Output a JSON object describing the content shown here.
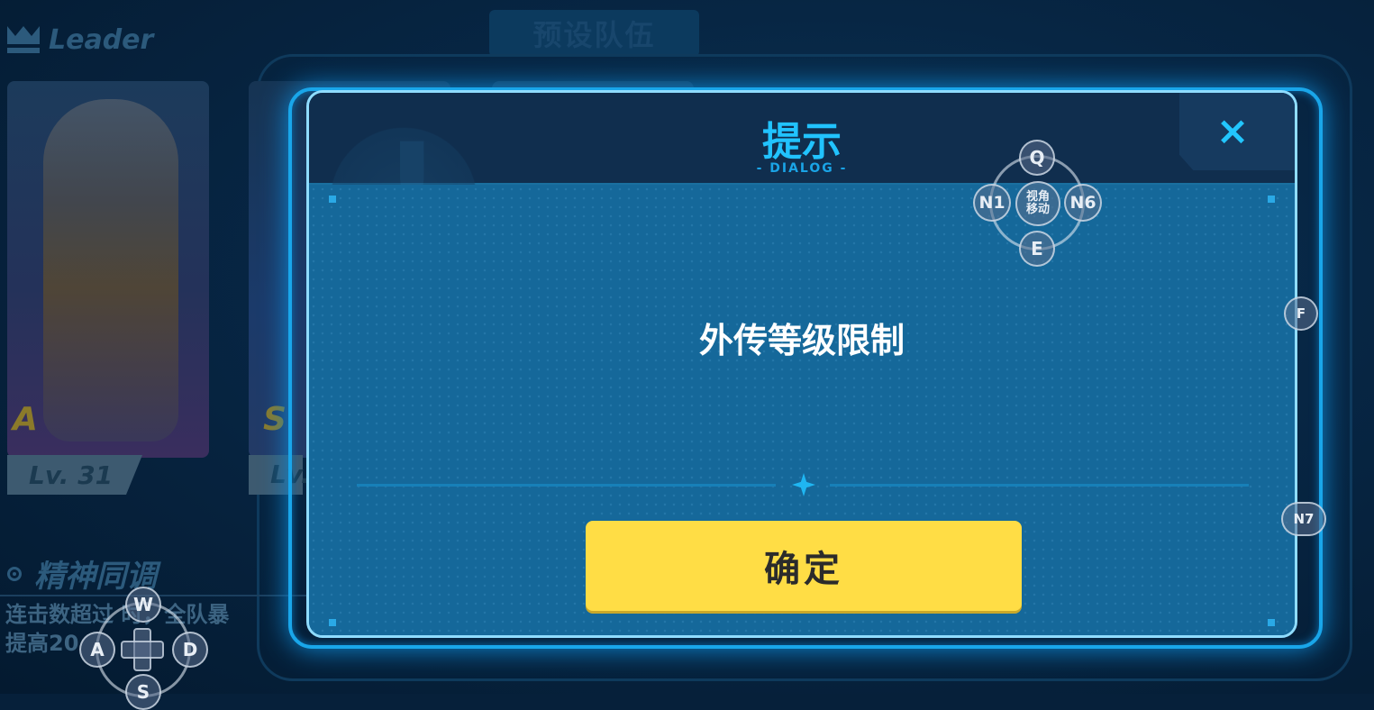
{
  "background": {
    "leader_label": "Leader",
    "preset_team_label": "预设队伍",
    "leader_card": {
      "rank": "A",
      "level": "Lv. 31"
    },
    "second_card": {
      "rank": "S",
      "level": "Lv."
    },
    "skill_title": "精神同调",
    "skill_desc_line1": "连击数超过 时，全队暴",
    "skill_desc_line2": "提高20"
  },
  "dialog": {
    "title": "提示",
    "subtitle": "- DIALOG -",
    "close_icon": "×",
    "message": "外传等级限制",
    "confirm_label": "确定",
    "colors": {
      "title": "#21c3ff",
      "confirm_bg": "#ffdd45",
      "panel": "#15689a",
      "border": "#19a6ea"
    }
  },
  "key_overlay": {
    "camera": {
      "up": "Q",
      "left": "N1",
      "center": "视角\n移动",
      "right": "N6",
      "down": "E"
    },
    "move": {
      "up": "W",
      "left": "A",
      "right": "D",
      "down": "S"
    },
    "side_keys": {
      "f": "F",
      "n7": "N7"
    }
  }
}
